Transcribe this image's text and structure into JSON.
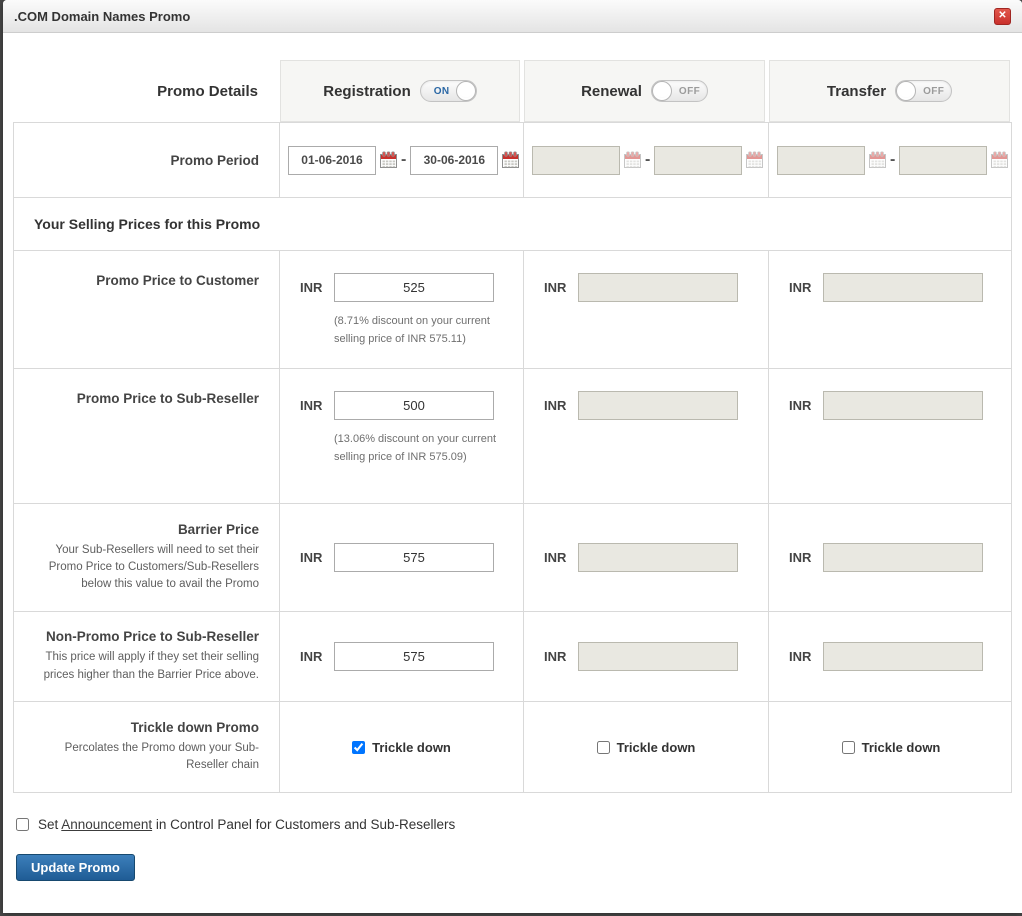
{
  "modal": {
    "title": ".COM Domain Names Promo",
    "close_icon": "✕"
  },
  "header": {
    "details_label": "Promo Details",
    "columns": [
      {
        "label": "Registration",
        "state": "ON"
      },
      {
        "label": "Renewal",
        "state": "OFF"
      },
      {
        "label": "Transfer",
        "state": "OFF"
      }
    ]
  },
  "promo_period": {
    "label": "Promo Period",
    "separator": "-",
    "registration": {
      "start": "01-06-2016",
      "end": "30-06-2016"
    }
  },
  "section": {
    "title": "Your Selling Prices for this Promo"
  },
  "currency_label": "INR",
  "price_rows": [
    {
      "label": "Promo Price to Customer",
      "registration_value": "525",
      "registration_note": "(8.71% discount on your current selling price of INR 575.11)"
    },
    {
      "label": "Promo Price to Sub-Reseller",
      "registration_value": "500",
      "registration_note": "(13.06% discount on your current selling price of INR 575.09)"
    },
    {
      "label": "Barrier Price",
      "description": "Your Sub-Resellers will need to set their Promo Price to Customers/Sub-Resellers below this value to avail the Promo",
      "registration_value": "575"
    },
    {
      "label": "Non-Promo Price to Sub-Reseller",
      "description": "This price will apply if they set their selling prices higher than the Barrier Price above.",
      "registration_value": "575"
    }
  ],
  "trickle": {
    "label": "Trickle down Promo",
    "description": "Percolates the Promo down your Sub-Reseller chain",
    "checkbox_label": "Trickle down",
    "registration_checked": true,
    "renewal_checked": false,
    "transfer_checked": false
  },
  "footer": {
    "announcement_checked": false,
    "announcement_prefix": "Set",
    "announcement_link": "Announcement",
    "announcement_suffix": "in Control Panel for Customers and Sub-Resellers",
    "update_button": "Update Promo"
  },
  "colors": {
    "toggle_on_blue": "#2a67a5",
    "button_blue": "#1f5c95",
    "close_red": "#c9302c",
    "calendar_red": "#c9302c",
    "disabled_field_bg": "#e9e8e1"
  }
}
